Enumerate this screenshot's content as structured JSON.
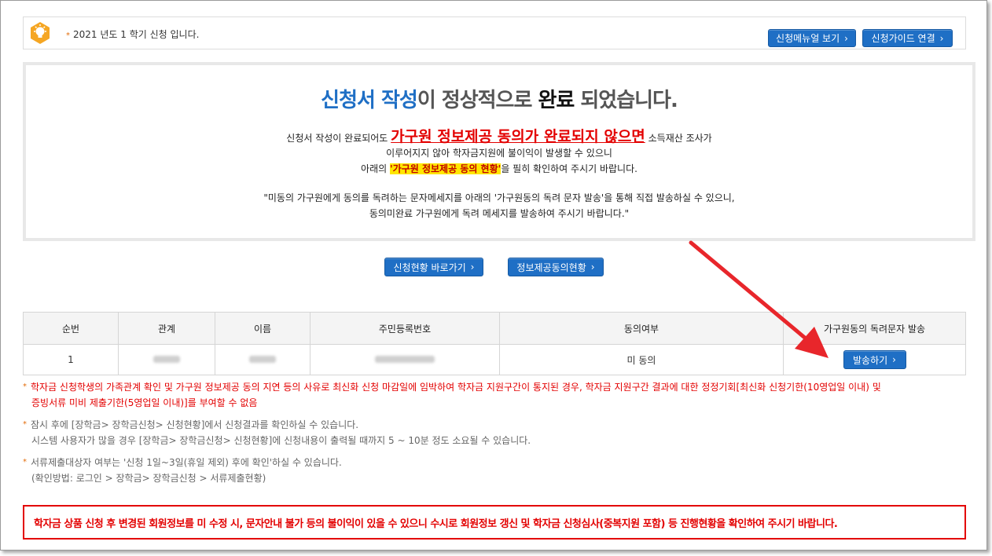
{
  "notice": {
    "text": "2021 년도 1 학기 신청 입니다.",
    "manual_button": "신청메뉴얼 보기",
    "guide_button": "신청가이드 연결"
  },
  "completion": {
    "title_part1": "신청서 작성",
    "title_part2": "이 정상적으로 ",
    "title_part3": "완료",
    "title_part4": " 되었습니다.",
    "line1_pre": "신청서 작성이 완료되어도 ",
    "line1_emph": "가구원 정보제공 동의가 완료되지 않으면",
    "line1_post": " 소득재산 조사가",
    "line2": "이루어지지 않아 학자금지원에 불이익이 발생할 수 있으니",
    "line3_pre": "아래의 ",
    "line3_hl": "'가구원 정보제공 동의 현황'",
    "line3_post": "을 필히 확인하여 주시기 바랍니다.",
    "line4": "\"미동의 가구원에게 동의를 독려하는 문자메세지를 아래의 '가구원동의 독려 문자 발송'을 통해 직접 발송하실 수 있으니,",
    "line5": "동의미완료 가구원에게 독려 메세지를 발송하여 주시기 바랍니다.\""
  },
  "actions": {
    "status_button": "신청현황 바로가기",
    "consent_button": "정보제공동의현황"
  },
  "table": {
    "headers": [
      "순번",
      "관계",
      "이름",
      "주민등록번호",
      "동의여부",
      "가구원동의 독려문자 발송"
    ],
    "rows": [
      {
        "no": "1",
        "consent": "미 동의",
        "send_button": "발송하기"
      }
    ]
  },
  "notes": {
    "red_line1": "학자금 신청학생의 가족관계 확인 및 가구원 정보제공 동의 지연 등의 사유로 최신화 신청 마감일에 임박하여 학자금 지원구간이 통지된 경우, 학자금 지원구간 결과에 대한 정정기회[최신화 신청기한(10영업일 이내) 및",
    "red_line2": "증빙서류 미비 제출기한(5영업일 이내)]를 부여할 수 없음",
    "gray1_line1": "잠시 후에 [장학금> 장학금신청> 신청현황]에서 신청결과를 확인하실 수 있습니다.",
    "gray1_line2": "시스템 사용자가 많을 경우 [장학금> 장학금신청> 신청현황]에 신청내용이 출력될 때까지 5 ~ 10분 정도 소요될 수 있습니다.",
    "gray2_line1": "서류제출대상자 여부는 '신청 1일~3일(휴일 제외) 후에 확인'하실 수 있습니다.",
    "gray2_line2": "(확인방법: 로그인 > 장학금> 장학금신청 > 서류제출현황)"
  },
  "warning": "학자금 상품 신청 후 변경된 회원정보를 미 수정 시, 문자안내 불가 등의 불이익이 있을 수 있으니 수시로 회원정보 갱신 및 학자금 신청심사(중복지원 포함) 등 진행현황을 확인하여 주시기 바랍니다.",
  "colors": {
    "accent_blue": "#1f6fc5",
    "alert_red": "#e30000",
    "highlight": "#ffe600"
  },
  "icons": {
    "notice": "lightbulb-icon",
    "button_chevron": "chevron-right-icon",
    "annotation": "red-arrow"
  }
}
